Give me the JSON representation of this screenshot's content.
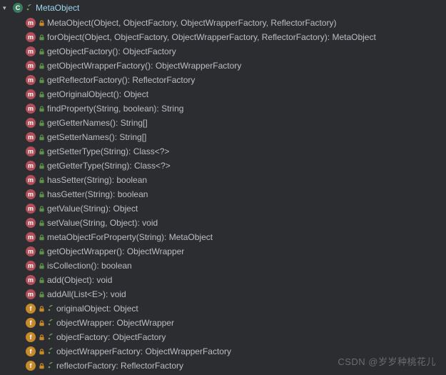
{
  "class": {
    "name": "MetaObject",
    "final": true
  },
  "members": [
    {
      "kind": "method",
      "lock": "private",
      "sig": "MetaObject(Object, ObjectFactory, ObjectWrapperFactory, ReflectorFactory)"
    },
    {
      "kind": "method",
      "lock": "public",
      "sig": "forObject(Object, ObjectFactory, ObjectWrapperFactory, ReflectorFactory): MetaObject"
    },
    {
      "kind": "method",
      "lock": "public",
      "sig": "getObjectFactory(): ObjectFactory"
    },
    {
      "kind": "method",
      "lock": "public",
      "sig": "getObjectWrapperFactory(): ObjectWrapperFactory"
    },
    {
      "kind": "method",
      "lock": "public",
      "sig": "getReflectorFactory(): ReflectorFactory"
    },
    {
      "kind": "method",
      "lock": "public",
      "sig": "getOriginalObject(): Object"
    },
    {
      "kind": "method",
      "lock": "public",
      "sig": "findProperty(String, boolean): String"
    },
    {
      "kind": "method",
      "lock": "public",
      "sig": "getGetterNames(): String[]"
    },
    {
      "kind": "method",
      "lock": "public",
      "sig": "getSetterNames(): String[]"
    },
    {
      "kind": "method",
      "lock": "public",
      "sig": "getSetterType(String): Class<?>"
    },
    {
      "kind": "method",
      "lock": "public",
      "sig": "getGetterType(String): Class<?>"
    },
    {
      "kind": "method",
      "lock": "public",
      "sig": "hasSetter(String): boolean"
    },
    {
      "kind": "method",
      "lock": "public",
      "sig": "hasGetter(String): boolean"
    },
    {
      "kind": "method",
      "lock": "public",
      "sig": "getValue(String): Object"
    },
    {
      "kind": "method",
      "lock": "public",
      "sig": "setValue(String, Object): void"
    },
    {
      "kind": "method",
      "lock": "public",
      "sig": "metaObjectForProperty(String): MetaObject"
    },
    {
      "kind": "method",
      "lock": "public",
      "sig": "getObjectWrapper(): ObjectWrapper"
    },
    {
      "kind": "method",
      "lock": "public",
      "sig": "isCollection(): boolean"
    },
    {
      "kind": "method",
      "lock": "public",
      "sig": "add(Object): void"
    },
    {
      "kind": "method",
      "lock": "public",
      "sig": "addAll(List<E>): void"
    },
    {
      "kind": "field",
      "lock": "private",
      "sig": "originalObject: Object"
    },
    {
      "kind": "field",
      "lock": "private",
      "sig": "objectWrapper: ObjectWrapper"
    },
    {
      "kind": "field",
      "lock": "private",
      "sig": "objectFactory: ObjectFactory"
    },
    {
      "kind": "field",
      "lock": "private",
      "sig": "objectWrapperFactory: ObjectWrapperFactory"
    },
    {
      "kind": "field",
      "lock": "private",
      "sig": "reflectorFactory: ReflectorFactory"
    }
  ],
  "watermark": "CSDN @岁岁种桃花儿"
}
